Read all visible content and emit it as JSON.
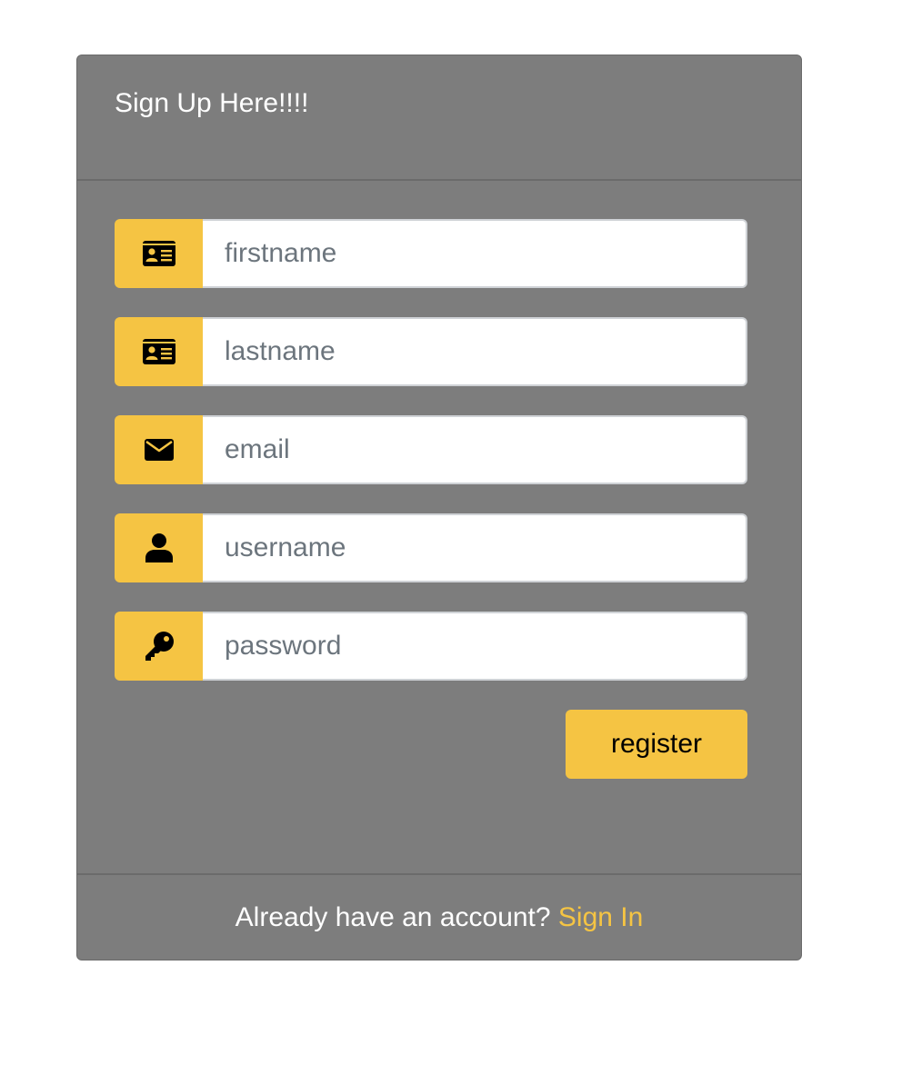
{
  "form": {
    "title": "Sign Up Here!!!!",
    "fields": [
      {
        "name": "firstname",
        "placeholder": "firstname",
        "value": "",
        "icon": "id-card-icon"
      },
      {
        "name": "lastname",
        "placeholder": "lastname",
        "value": "",
        "icon": "id-card-icon"
      },
      {
        "name": "email",
        "placeholder": "email",
        "value": "",
        "icon": "envelope-icon"
      },
      {
        "name": "username",
        "placeholder": "username",
        "value": "",
        "icon": "user-icon"
      },
      {
        "name": "password",
        "placeholder": "password",
        "value": "",
        "icon": "key-icon"
      }
    ],
    "register_label": "register"
  },
  "footer": {
    "prompt": "Already have an account?",
    "signin_label": "Sign In"
  },
  "colors": {
    "card_background": "#7d7d7d",
    "accent": "#f5c443",
    "text": "#ffffff"
  }
}
